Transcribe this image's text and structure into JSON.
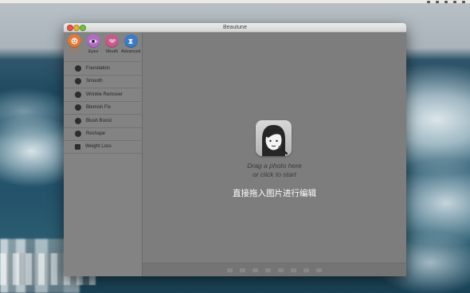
{
  "window": {
    "title": "Beautune"
  },
  "sidebar": {
    "tabs": [
      {
        "label": "Face",
        "icon": "face-icon",
        "color": "#e07a3a",
        "active": true
      },
      {
        "label": "Eyes",
        "icon": "eye-icon",
        "color": "#b06cc4",
        "active": false
      },
      {
        "label": "Mouth",
        "icon": "lips-icon",
        "color": "#c65a8a",
        "active": false
      },
      {
        "label": "Advanced",
        "icon": "advanced-icon",
        "color": "#3d7cc4",
        "active": false
      }
    ],
    "items": [
      {
        "label": "Foundation",
        "icon": "foundation-icon"
      },
      {
        "label": "Smooth",
        "icon": "smooth-icon"
      },
      {
        "label": "Wrinkle Remover",
        "icon": "wrinkle-remover-icon"
      },
      {
        "label": "Blemish Fix",
        "icon": "blemish-fix-icon"
      },
      {
        "label": "Blush Boost",
        "icon": "blush-boost-icon"
      },
      {
        "label": "Reshape",
        "icon": "reshape-icon"
      },
      {
        "label": "Weight Loss",
        "icon": "weight-loss-icon"
      }
    ]
  },
  "main": {
    "drop_line1": "Drag a photo here",
    "drop_line2": "or click to start",
    "chinese_hint": "直接拖入图片进行编辑"
  },
  "colors": {
    "accent": "#d56b2c",
    "window_bg": "#7e7e7e"
  }
}
